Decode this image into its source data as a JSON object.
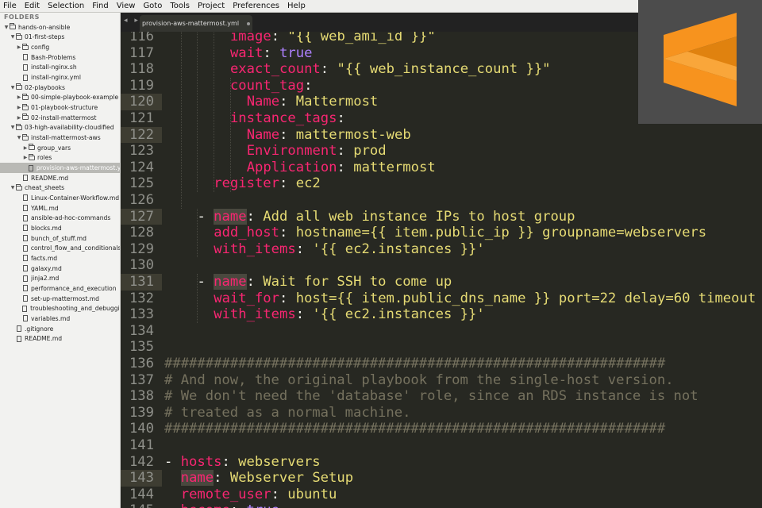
{
  "menu": [
    "File",
    "Edit",
    "Selection",
    "Find",
    "View",
    "Goto",
    "Tools",
    "Project",
    "Preferences",
    "Help"
  ],
  "sidebar": {
    "title": "FOLDERS",
    "items": [
      {
        "label": "hands-on-ansible",
        "type": "folder",
        "depth": 0,
        "open": true
      },
      {
        "label": "01-first-steps",
        "type": "folder",
        "depth": 1,
        "open": true
      },
      {
        "label": "config",
        "type": "folder",
        "depth": 2,
        "open": false
      },
      {
        "label": "Bash-Problems",
        "type": "file",
        "depth": 2
      },
      {
        "label": "install-nginx.sh",
        "type": "file",
        "depth": 2
      },
      {
        "label": "install-nginx.yml",
        "type": "file",
        "depth": 2
      },
      {
        "label": "02-playbooks",
        "type": "folder",
        "depth": 1,
        "open": true
      },
      {
        "label": "00-simple-playbook-example",
        "type": "folder",
        "depth": 2,
        "open": false
      },
      {
        "label": "01-playbook-structure",
        "type": "folder",
        "depth": 2,
        "open": false
      },
      {
        "label": "02-install-mattermost",
        "type": "folder",
        "depth": 2,
        "open": false
      },
      {
        "label": "03-high-availability-cloudified",
        "type": "folder",
        "depth": 1,
        "open": true
      },
      {
        "label": "install-mattermost-aws",
        "type": "folder",
        "depth": 2,
        "open": true
      },
      {
        "label": "group_vars",
        "type": "folder",
        "depth": 3,
        "open": false
      },
      {
        "label": "roles",
        "type": "folder",
        "depth": 3,
        "open": false
      },
      {
        "label": "provision-aws-mattermost.yml",
        "type": "file",
        "depth": 3,
        "selected": true
      },
      {
        "label": "README.md",
        "type": "file",
        "depth": 2
      },
      {
        "label": "cheat_sheets",
        "type": "folder",
        "depth": 1,
        "open": true
      },
      {
        "label": "Linux-Container-Workflow.md",
        "type": "file",
        "depth": 2
      },
      {
        "label": "YAML.md",
        "type": "file",
        "depth": 2
      },
      {
        "label": "ansible-ad-hoc-commands",
        "type": "file",
        "depth": 2
      },
      {
        "label": "blocks.md",
        "type": "file",
        "depth": 2
      },
      {
        "label": "bunch_of_stuff.md",
        "type": "file",
        "depth": 2
      },
      {
        "label": "control_flow_and_conditionals",
        "type": "file",
        "depth": 2
      },
      {
        "label": "facts.md",
        "type": "file",
        "depth": 2
      },
      {
        "label": "galaxy.md",
        "type": "file",
        "depth": 2
      },
      {
        "label": "jinja2.md",
        "type": "file",
        "depth": 2
      },
      {
        "label": "performance_and_execution",
        "type": "file",
        "depth": 2
      },
      {
        "label": "set-up-mattermost.md",
        "type": "file",
        "depth": 2
      },
      {
        "label": "troubleshooting_and_debugging",
        "type": "file",
        "depth": 2
      },
      {
        "label": "variables.md",
        "type": "file",
        "depth": 2
      },
      {
        "label": ".gitignore",
        "type": "file",
        "depth": 1
      },
      {
        "label": "README.md",
        "type": "file",
        "depth": 1
      }
    ]
  },
  "tab": {
    "label": "provision-aws-mattermost.yml",
    "nav": "◂ ▸"
  },
  "editor": {
    "lines": [
      {
        "n": "116",
        "indent": 8,
        "segs": [
          [
            "k",
            "image"
          ],
          [
            "p",
            ": "
          ],
          [
            "s",
            "\"{{ web_ami_id }}\""
          ]
        ]
      },
      {
        "n": "117",
        "indent": 8,
        "segs": [
          [
            "k",
            "wait"
          ],
          [
            "p",
            ": "
          ],
          [
            "b",
            "true"
          ]
        ]
      },
      {
        "n": "118",
        "indent": 8,
        "segs": [
          [
            "k",
            "exact_count"
          ],
          [
            "p",
            ": "
          ],
          [
            "s",
            "\"{{ web_instance_count }}\""
          ]
        ]
      },
      {
        "n": "119",
        "indent": 8,
        "segs": [
          [
            "k",
            "count_tag"
          ],
          [
            "p",
            ":"
          ]
        ]
      },
      {
        "n": "120",
        "indent": 10,
        "hl": true,
        "segs": [
          [
            "k",
            "Name"
          ],
          [
            "p",
            ": "
          ],
          [
            "s",
            "Mattermost"
          ]
        ]
      },
      {
        "n": "121",
        "indent": 8,
        "segs": [
          [
            "k",
            "instance_tags"
          ],
          [
            "p",
            ":"
          ]
        ]
      },
      {
        "n": "122",
        "indent": 10,
        "hl": true,
        "segs": [
          [
            "k",
            "Name"
          ],
          [
            "p",
            ": "
          ],
          [
            "s",
            "mattermost-web"
          ]
        ]
      },
      {
        "n": "123",
        "indent": 10,
        "segs": [
          [
            "k",
            "Environment"
          ],
          [
            "p",
            ": "
          ],
          [
            "s",
            "prod"
          ]
        ]
      },
      {
        "n": "124",
        "indent": 10,
        "segs": [
          [
            "k",
            "Application"
          ],
          [
            "p",
            ": "
          ],
          [
            "s",
            "mattermost"
          ]
        ]
      },
      {
        "n": "125",
        "indent": 6,
        "segs": [
          [
            "k",
            "register"
          ],
          [
            "p",
            ": "
          ],
          [
            "s",
            "ec2"
          ]
        ]
      },
      {
        "n": "126",
        "indent": 0,
        "segs": []
      },
      {
        "n": "127",
        "indent": 4,
        "hl": true,
        "segs": [
          [
            "p",
            "- "
          ],
          [
            "kh",
            "name"
          ],
          [
            "p",
            ": "
          ],
          [
            "s",
            "Add all web instance IPs to host group"
          ]
        ]
      },
      {
        "n": "128",
        "indent": 6,
        "segs": [
          [
            "k",
            "add_host"
          ],
          [
            "p",
            ": "
          ],
          [
            "s",
            "hostname={{ item.public_ip }} groupname=webservers"
          ]
        ]
      },
      {
        "n": "129",
        "indent": 6,
        "segs": [
          [
            "k",
            "with_items"
          ],
          [
            "p",
            ": "
          ],
          [
            "s",
            "'{{ ec2.instances }}'"
          ]
        ]
      },
      {
        "n": "130",
        "indent": 0,
        "segs": []
      },
      {
        "n": "131",
        "indent": 4,
        "hl": true,
        "segs": [
          [
            "p",
            "- "
          ],
          [
            "kh",
            "name"
          ],
          [
            "p",
            ": "
          ],
          [
            "s",
            "Wait for SSH to come up"
          ]
        ]
      },
      {
        "n": "132",
        "indent": 6,
        "segs": [
          [
            "k",
            "wait_for"
          ],
          [
            "p",
            ": "
          ],
          [
            "s",
            "host={{ item.public_dns_name }} port=22 delay=60 timeout"
          ]
        ]
      },
      {
        "n": "133",
        "indent": 6,
        "segs": [
          [
            "k",
            "with_items"
          ],
          [
            "p",
            ": "
          ],
          [
            "s",
            "'{{ ec2.instances }}'"
          ]
        ]
      },
      {
        "n": "134",
        "indent": 0,
        "segs": []
      },
      {
        "n": "135",
        "indent": 0,
        "segs": []
      },
      {
        "n": "136",
        "indent": 0,
        "segs": [
          [
            "c",
            "#############################################################"
          ]
        ]
      },
      {
        "n": "137",
        "indent": 0,
        "segs": [
          [
            "c",
            "# And now, the original playbook from the single-host version."
          ]
        ]
      },
      {
        "n": "138",
        "indent": 0,
        "segs": [
          [
            "c",
            "# We don't need the 'database' role, since an RDS instance is not"
          ]
        ]
      },
      {
        "n": "139",
        "indent": 0,
        "segs": [
          [
            "c",
            "# treated as a normal machine."
          ]
        ]
      },
      {
        "n": "140",
        "indent": 0,
        "segs": [
          [
            "c",
            "#############################################################"
          ]
        ]
      },
      {
        "n": "141",
        "indent": 0,
        "segs": []
      },
      {
        "n": "142",
        "indent": 0,
        "segs": [
          [
            "p",
            "- "
          ],
          [
            "k",
            "hosts"
          ],
          [
            "p",
            ": "
          ],
          [
            "s",
            "webservers"
          ]
        ]
      },
      {
        "n": "143",
        "indent": 2,
        "hl": true,
        "segs": [
          [
            "kh",
            "name"
          ],
          [
            "p",
            ": "
          ],
          [
            "s",
            "Webserver Setup"
          ]
        ]
      },
      {
        "n": "144",
        "indent": 2,
        "segs": [
          [
            "k",
            "remote_user"
          ],
          [
            "p",
            ": "
          ],
          [
            "s",
            "ubuntu"
          ]
        ]
      },
      {
        "n": "145",
        "indent": 2,
        "segs": [
          [
            "k",
            "become"
          ],
          [
            "p",
            ": "
          ],
          [
            "b",
            "true"
          ]
        ]
      }
    ]
  },
  "colors": {
    "background": "#272822",
    "key": "#f92672",
    "string": "#e6db74",
    "bool": "#ae81ff",
    "comment": "#75715e",
    "logo_orange": "#f99b1c"
  },
  "logo": {
    "icon": "sublime-text-logo"
  }
}
